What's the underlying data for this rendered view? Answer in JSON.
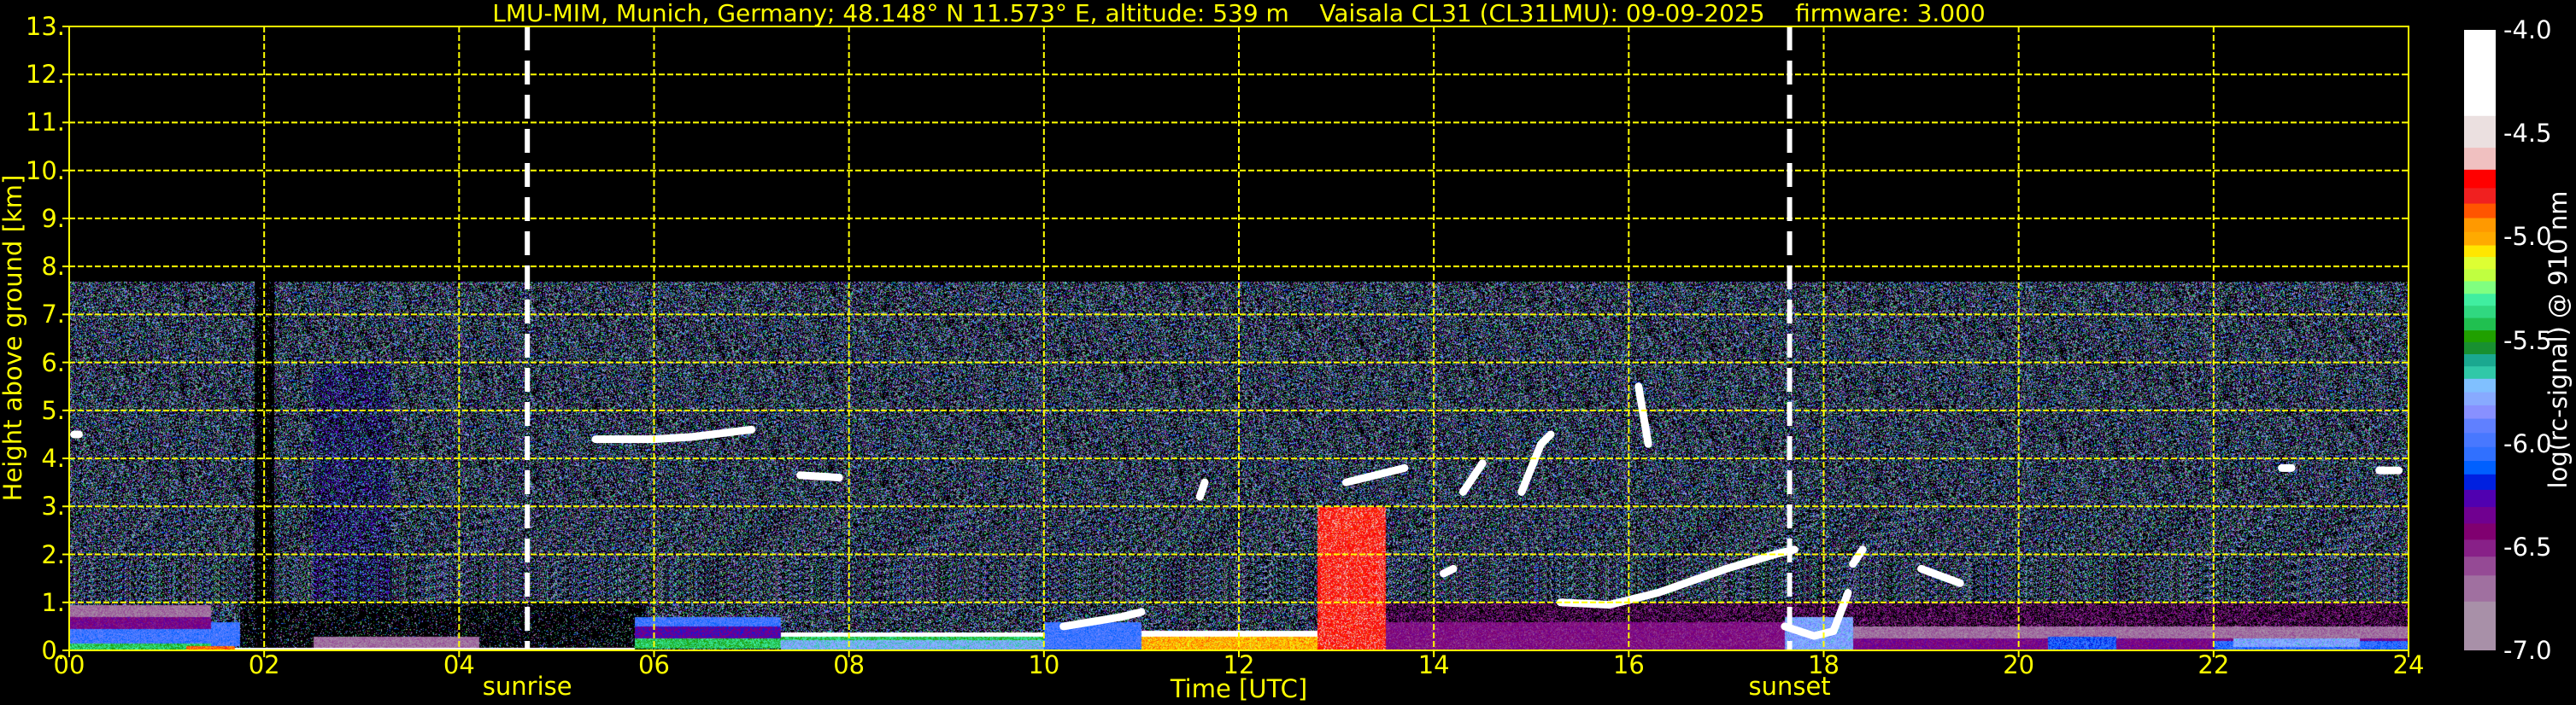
{
  "chart_data": {
    "type": "heatmap",
    "title": "LMU-MIM, Munich, Germany; 48.148° N 11.573° E, altitude: 539 m    Vaisala CL31 (CL31LMU): 09-09-2025    firmware: 3.000",
    "xlabel": "Time [UTC]",
    "ylabel": "Height above ground [km]",
    "xlim": [
      0,
      24
    ],
    "ylim": [
      0,
      13
    ],
    "x_ticks": [
      "00",
      "02",
      "04",
      "06",
      "08",
      "10",
      "12",
      "14",
      "16",
      "18",
      "20",
      "22",
      "24"
    ],
    "y_ticks": [
      "0.",
      "1.",
      "2.",
      "3.",
      "4.",
      "5.",
      "6.",
      "7.",
      "8.",
      "9.",
      "10.",
      "11.",
      "12.",
      "13."
    ],
    "grid": true,
    "max_range_km": 7.7,
    "events": [
      {
        "label": "sunrise",
        "time": 4.7
      },
      {
        "label": "sunset",
        "time": 17.65
      }
    ],
    "colorbar": {
      "label": "log(rc-signal) @ 910 nm",
      "range": [
        -7.0,
        -4.0
      ],
      "tick_labels": [
        "-4.0",
        "-4.5",
        "-5.0",
        "-5.5",
        "-6.0",
        "-6.5",
        "-7.0"
      ],
      "levels": [
        {
          "from": -4.0,
          "to": -4.416,
          "color": "#ffffff"
        },
        {
          "from": -4.416,
          "to": -4.57,
          "color": "#ebe0e0"
        },
        {
          "from": -4.57,
          "to": -4.676,
          "color": "#f0c0c0"
        },
        {
          "from": -4.676,
          "to": -4.765,
          "color": "#ff0000"
        },
        {
          "from": -4.765,
          "to": -4.84,
          "color": "#f02020"
        },
        {
          "from": -4.84,
          "to": -4.91,
          "color": "#ff5500"
        },
        {
          "from": -4.91,
          "to": -4.977,
          "color": "#ff9900"
        },
        {
          "from": -4.977,
          "to": -5.042,
          "color": "#ffaa00"
        },
        {
          "from": -5.042,
          "to": -5.098,
          "color": "#ffe600"
        },
        {
          "from": -5.098,
          "to": -5.157,
          "color": "#ddff33"
        },
        {
          "from": -5.157,
          "to": -5.215,
          "color": "#c0ff40"
        },
        {
          "from": -5.215,
          "to": -5.276,
          "color": "#80ff80"
        },
        {
          "from": -5.276,
          "to": -5.334,
          "color": "#40eea0"
        },
        {
          "from": -5.334,
          "to": -5.393,
          "color": "#30d880"
        },
        {
          "from": -5.393,
          "to": -5.453,
          "color": "#20c050"
        },
        {
          "from": -5.453,
          "to": -5.51,
          "color": "#20a000"
        },
        {
          "from": -5.51,
          "to": -5.568,
          "color": "#189030"
        },
        {
          "from": -5.568,
          "to": -5.627,
          "color": "#1aa890"
        },
        {
          "from": -5.627,
          "to": -5.687,
          "color": "#30c8a8"
        },
        {
          "from": -5.687,
          "to": -5.752,
          "color": "#80c0ff"
        },
        {
          "from": -5.752,
          "to": -5.815,
          "color": "#88aaff"
        },
        {
          "from": -5.815,
          "to": -5.88,
          "color": "#8890ff"
        },
        {
          "from": -5.88,
          "to": -5.949,
          "color": "#6080ff"
        },
        {
          "from": -5.949,
          "to": -6.017,
          "color": "#4878ff"
        },
        {
          "from": -6.017,
          "to": -6.084,
          "color": "#3070ff"
        },
        {
          "from": -6.084,
          "to": -6.149,
          "color": "#0060ff"
        },
        {
          "from": -6.149,
          "to": -6.224,
          "color": "#0020e0"
        },
        {
          "from": -6.224,
          "to": -6.307,
          "color": "#5000b0"
        },
        {
          "from": -6.307,
          "to": -6.387,
          "color": "#700090"
        },
        {
          "from": -6.387,
          "to": -6.465,
          "color": "#800070"
        },
        {
          "from": -6.465,
          "to": -6.547,
          "color": "#882088"
        },
        {
          "from": -6.547,
          "to": -6.638,
          "color": "#954a95"
        },
        {
          "from": -6.638,
          "to": -6.764,
          "color": "#a070a0"
        },
        {
          "from": -6.764,
          "to": -7.0,
          "color": "#a890a8"
        }
      ]
    },
    "aerosol_layers": [
      {
        "time": [
          0,
          1.45
        ],
        "height": [
          0,
          0.15
        ],
        "value": -5.4
      },
      {
        "time": [
          0,
          1.45
        ],
        "height": [
          0.15,
          0.45
        ],
        "value": -6.0
      },
      {
        "time": [
          0,
          1.45
        ],
        "height": [
          0.45,
          0.7
        ],
        "value": -6.4
      },
      {
        "time": [
          0,
          1.45
        ],
        "height": [
          0.7,
          0.95
        ],
        "value": -6.7
      },
      {
        "time": [
          1.2,
          1.7
        ],
        "height": [
          0,
          0.1
        ],
        "value": -4.9
      },
      {
        "time": [
          1.45,
          1.75
        ],
        "height": [
          0.1,
          0.6
        ],
        "value": -6.0
      },
      {
        "time": [
          1.7,
          5.8
        ],
        "height": [
          0,
          0.07
        ],
        "value": -4.2
      },
      {
        "time": [
          2.5,
          4.2
        ],
        "height": [
          0.07,
          0.3
        ],
        "value": -6.7
      },
      {
        "time": [
          5.8,
          7.3
        ],
        "height": [
          0.05,
          0.25
        ],
        "value": -5.4
      },
      {
        "time": [
          5.8,
          7.3
        ],
        "height": [
          0.25,
          0.5
        ],
        "value": -6.3
      },
      {
        "time": [
          5.8,
          7.3
        ],
        "height": [
          0.5,
          0.7
        ],
        "value": -6.0
      },
      {
        "time": [
          7.3,
          10
        ],
        "height": [
          0,
          0.22
        ],
        "value": -5.75
      },
      {
        "time": [
          7.3,
          10
        ],
        "height": [
          0.22,
          0.3
        ],
        "value": -5.4
      },
      {
        "time": [
          7.3,
          10
        ],
        "height": [
          0.3,
          0.38
        ],
        "value": -4.2
      },
      {
        "time": [
          10,
          11
        ],
        "height": [
          0,
          0.6
        ],
        "value": -6.0
      },
      {
        "time": [
          11,
          12.8
        ],
        "height": [
          0,
          0.3
        ],
        "value": -5.0
      },
      {
        "time": [
          11,
          12.8
        ],
        "height": [
          0.3,
          0.42
        ],
        "value": -4.2
      },
      {
        "time": [
          12.8,
          13.5
        ],
        "height": [
          0,
          3.0
        ],
        "value": -4.75
      },
      {
        "time": [
          13.5,
          17.6
        ],
        "height": [
          0,
          0.6
        ],
        "value": -6.45
      },
      {
        "time": [
          17.6,
          18.3
        ],
        "height": [
          0,
          0.7
        ],
        "value": -5.8
      },
      {
        "time": [
          18.3,
          24
        ],
        "height": [
          0,
          0.25
        ],
        "value": -6.4
      },
      {
        "time": [
          18.3,
          24
        ],
        "height": [
          0.25,
          0.5
        ],
        "value": -6.7
      },
      {
        "time": [
          20.3,
          21
        ],
        "height": [
          0,
          0.3
        ],
        "value": -6.1
      },
      {
        "time": [
          22,
          24
        ],
        "height": [
          0,
          0.2
        ],
        "value": -6.05
      },
      {
        "time": [
          22.2,
          23.5
        ],
        "height": [
          0.08,
          0.25
        ],
        "value": -5.8
      }
    ],
    "cloud_traces": [
      {
        "value": -4.0,
        "points": [
          [
            5.4,
            4.4
          ],
          [
            6.0,
            4.4
          ],
          [
            6.4,
            4.45
          ],
          [
            7.0,
            4.6
          ]
        ]
      },
      {
        "value": -4.0,
        "points": [
          [
            7.5,
            3.65
          ],
          [
            7.9,
            3.6
          ]
        ]
      },
      {
        "value": -4.0,
        "points": [
          [
            11.6,
            3.2
          ],
          [
            11.65,
            3.5
          ]
        ]
      },
      {
        "value": -4.0,
        "points": [
          [
            13.1,
            3.5
          ],
          [
            13.5,
            3.7
          ],
          [
            13.7,
            3.8
          ]
        ]
      },
      {
        "value": -4.0,
        "points": [
          [
            14.5,
            3.9
          ],
          [
            14.3,
            3.3
          ]
        ]
      },
      {
        "value": -4.0,
        "points": [
          [
            15.2,
            4.5
          ],
          [
            15.1,
            4.3
          ],
          [
            14.9,
            3.3
          ]
        ]
      },
      {
        "value": -4.0,
        "points": [
          [
            16.1,
            5.5
          ],
          [
            16.2,
            4.3
          ]
        ]
      },
      {
        "value": -4.0,
        "points": [
          [
            15.3,
            1.0
          ],
          [
            15.8,
            0.95
          ],
          [
            16.3,
            1.2
          ],
          [
            17.0,
            1.7
          ],
          [
            17.5,
            2.0
          ],
          [
            17.7,
            2.1
          ]
        ]
      },
      {
        "value": -4.0,
        "points": [
          [
            18.3,
            1.8
          ],
          [
            18.4,
            2.1
          ]
        ]
      },
      {
        "value": -4.0,
        "points": [
          [
            19.0,
            1.7
          ],
          [
            19.4,
            1.4
          ]
        ]
      },
      {
        "value": -4.0,
        "points": [
          [
            14.1,
            1.6
          ],
          [
            14.2,
            1.7
          ]
        ]
      },
      {
        "value": -4.0,
        "points": [
          [
            22.7,
            3.8
          ],
          [
            22.8,
            3.8
          ]
        ]
      },
      {
        "value": -4.0,
        "points": [
          [
            23.7,
            3.75
          ],
          [
            23.9,
            3.75
          ]
        ]
      },
      {
        "value": -4.0,
        "points": [
          [
            0.05,
            4.5
          ],
          [
            0.1,
            4.5
          ]
        ]
      },
      {
        "value": -4.0,
        "points": [
          [
            10.2,
            0.5
          ],
          [
            10.8,
            0.7
          ],
          [
            11.0,
            0.8
          ]
        ]
      },
      {
        "value": -4.0,
        "points": [
          [
            17.6,
            0.5
          ],
          [
            17.9,
            0.3
          ],
          [
            18.1,
            0.4
          ],
          [
            18.25,
            1.2
          ]
        ]
      }
    ]
  }
}
